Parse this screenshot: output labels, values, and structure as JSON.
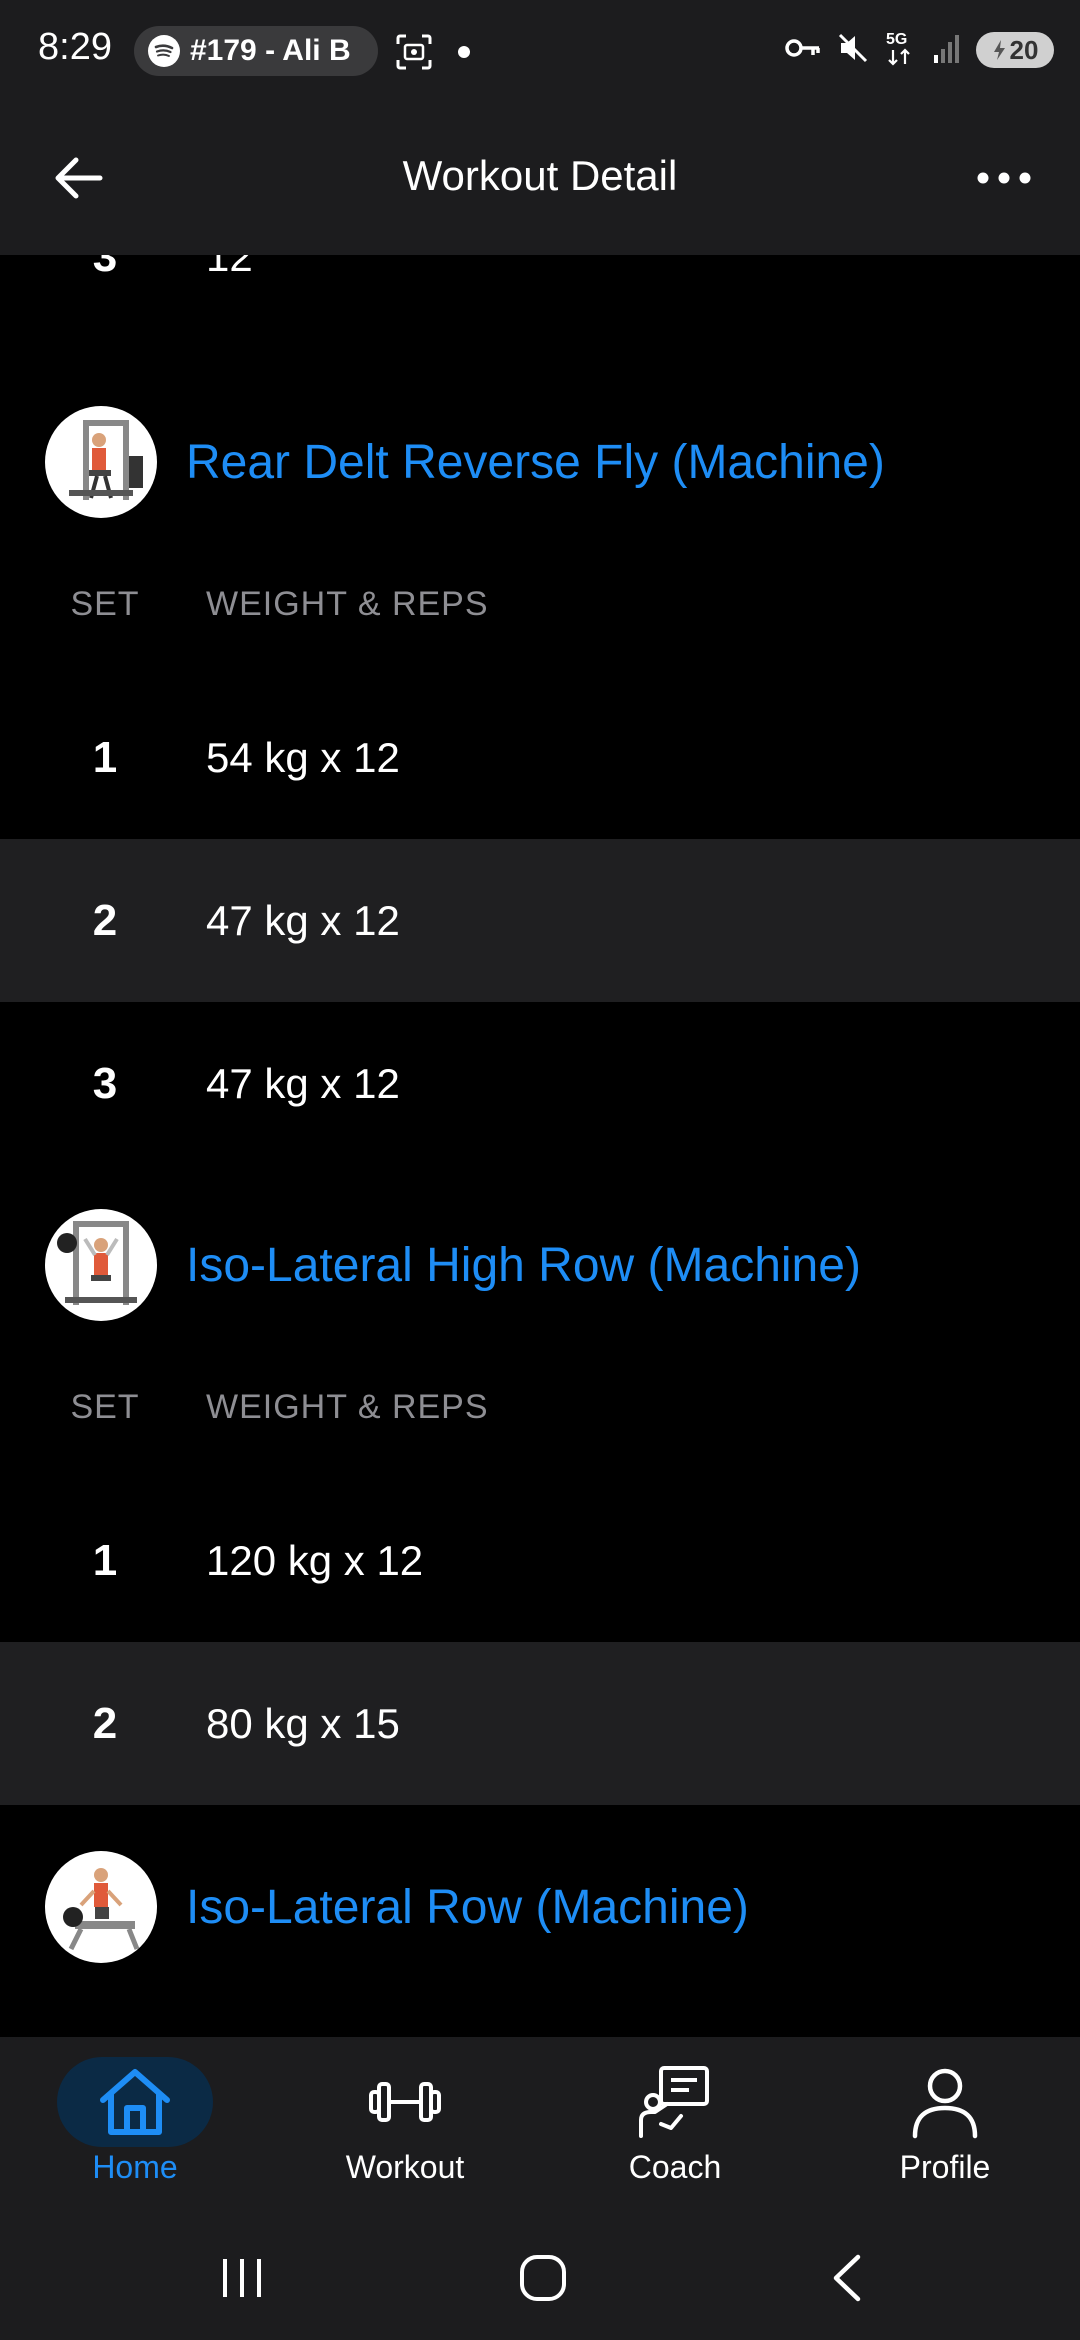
{
  "status_bar": {
    "time": "8:29",
    "media_text": "#179 - Ali B",
    "battery": "20",
    "icons": [
      "spotify-icon",
      "screenshot-icon",
      "vpn-key-icon",
      "mute-icon",
      "5g-icon",
      "signal-icon",
      "battery-icon"
    ]
  },
  "app_bar": {
    "title": "Workout Detail",
    "back_icon": "arrow-left-icon",
    "more_icon": "more-horizontal-icon"
  },
  "colors": {
    "accent": "#1e8df5",
    "background": "#000000",
    "surface": "#1c1c1e",
    "row_alt": "#1f1f21",
    "muted": "#8e8e93"
  },
  "workout": {
    "partial_row": {
      "set": "3",
      "value": "12"
    },
    "exercises": [
      {
        "name": "Rear Delt Reverse Fly (Machine)",
        "col_set": "SET",
        "col_weight_reps": "WEIGHT & REPS",
        "sets": [
          {
            "set": "1",
            "value": "54 kg x 12"
          },
          {
            "set": "2",
            "value": "47 kg x 12"
          },
          {
            "set": "3",
            "value": "47 kg x 12"
          }
        ]
      },
      {
        "name": "Iso-Lateral High Row (Machine)",
        "col_set": "SET",
        "col_weight_reps": "WEIGHT & REPS",
        "sets": [
          {
            "set": "1",
            "value": "120 kg x 12"
          },
          {
            "set": "2",
            "value": "80 kg x 15"
          }
        ]
      },
      {
        "name": "Iso-Lateral Row (Machine)"
      }
    ]
  },
  "bottom_nav": {
    "items": [
      {
        "label": "Home",
        "icon": "home-icon",
        "active": true
      },
      {
        "label": "Workout",
        "icon": "dumbbell-icon",
        "active": false
      },
      {
        "label": "Coach",
        "icon": "coach-icon",
        "active": false
      },
      {
        "label": "Profile",
        "icon": "profile-icon",
        "active": false
      }
    ]
  },
  "system_nav": {
    "icons": [
      "recent-apps-icon",
      "home-circle-icon",
      "system-back-icon"
    ]
  }
}
